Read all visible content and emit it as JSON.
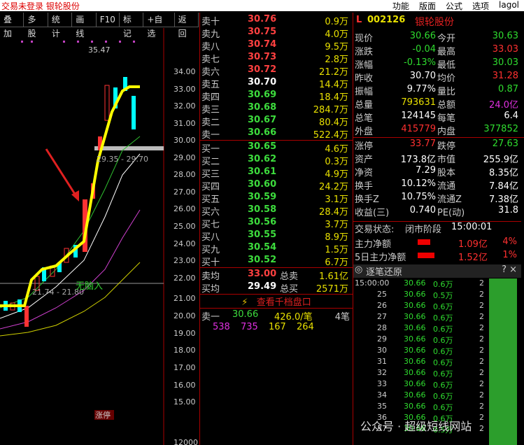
{
  "window": {
    "title": "交易未登录  银轮股份",
    "menus": [
      "功能",
      "版面",
      "公式",
      "选项",
      "lagol"
    ]
  },
  "toolbar": [
    "叠加",
    "多股",
    "统计",
    "画线",
    "F10",
    "标记",
    "+自选",
    "返回"
  ],
  "chart": {
    "price_axis": [
      "34.00",
      "33.00",
      "32.00",
      "31.00",
      "30.00",
      "29.00",
      "28.00",
      "27.00",
      "26.00",
      "25.00",
      "24.00",
      "23.00",
      "22.00",
      "21.00",
      "20.00",
      "19.00",
      "18.00",
      "17.00",
      "16.00",
      "15.00",
      "12000"
    ],
    "annotations": {
      "high": "35.47",
      "range1": "29.35 - 29.70",
      "range2": "21.74 - 21.80",
      "note": "无脑入",
      "tag": "涨停"
    }
  },
  "orderbook": {
    "asks": [
      {
        "label": "卖十",
        "price": "30.76",
        "vol": "0.9万",
        "p": "r"
      },
      {
        "label": "卖九",
        "price": "30.75",
        "vol": "4.0万",
        "p": "r"
      },
      {
        "label": "卖八",
        "price": "30.74",
        "vol": "9.5万",
        "p": "r"
      },
      {
        "label": "卖七",
        "price": "30.73",
        "vol": "2.8万",
        "p": "r"
      },
      {
        "label": "卖六",
        "price": "30.72",
        "vol": "21.2万",
        "p": "r"
      },
      {
        "label": "卖五",
        "price": "30.70",
        "vol": "14.4万",
        "p": "w"
      },
      {
        "label": "卖四",
        "price": "30.69",
        "vol": "18.4万",
        "p": "g"
      },
      {
        "label": "卖三",
        "price": "30.68",
        "vol": "284.7万",
        "p": "g"
      },
      {
        "label": "卖二",
        "price": "30.67",
        "vol": "80.4万",
        "p": "g"
      },
      {
        "label": "卖一",
        "price": "30.66",
        "vol": "522.4万",
        "p": "g"
      }
    ],
    "bids": [
      {
        "label": "买一",
        "price": "30.65",
        "vol": "4.6万",
        "p": "g"
      },
      {
        "label": "买二",
        "price": "30.62",
        "vol": "0.3万",
        "p": "g"
      },
      {
        "label": "买三",
        "price": "30.61",
        "vol": "4.9万",
        "p": "g"
      },
      {
        "label": "买四",
        "price": "30.60",
        "vol": "24.2万",
        "p": "g"
      },
      {
        "label": "买五",
        "price": "30.59",
        "vol": "3.1万",
        "p": "g"
      },
      {
        "label": "买六",
        "price": "30.58",
        "vol": "28.4万",
        "p": "g"
      },
      {
        "label": "买七",
        "price": "30.56",
        "vol": "3.7万",
        "p": "g"
      },
      {
        "label": "买八",
        "price": "30.55",
        "vol": "8.9万",
        "p": "g"
      },
      {
        "label": "买九",
        "price": "30.54",
        "vol": "1.5万",
        "p": "g"
      },
      {
        "label": "买十",
        "price": "30.52",
        "vol": "6.7万",
        "p": "g"
      }
    ],
    "avg_sell": {
      "label": "卖均",
      "price": "33.00",
      "total_label": "总卖",
      "total": "1.61亿"
    },
    "avg_buy": {
      "label": "买均",
      "price": "29.49",
      "total_label": "总买",
      "total": "2571万"
    },
    "button": "查看千档盘口",
    "detail": {
      "label": "卖一",
      "price": "30.66",
      "vol": "426.0/笔",
      "count": "4笔",
      "orders": [
        "538",
        "735",
        "167",
        "264"
      ]
    }
  },
  "quote": {
    "code": "002126",
    "name": "银轮股份",
    "rows": [
      [
        "现价",
        "30.66",
        "今开",
        "30.63",
        "grn",
        "grn"
      ],
      [
        "涨跌",
        "-0.04",
        "最高",
        "33.03",
        "grn",
        "red"
      ],
      [
        "涨幅",
        "-0.13%",
        "最低",
        "30.03",
        "grn",
        "grn"
      ],
      [
        "昨收",
        "30.70",
        "均价",
        "31.28",
        "wht",
        "red"
      ],
      [
        "振幅",
        "9.77%",
        "量比",
        "0.87",
        "wht",
        "grn"
      ],
      [
        "总量",
        "793631",
        "总额",
        "24.0亿",
        "yel",
        "mag"
      ],
      [
        "总笔",
        "124145",
        "每笔",
        "6.4",
        "wht",
        "wht"
      ],
      [
        "外盘",
        "415779",
        "内盘",
        "377852",
        "red",
        "grn"
      ],
      [
        "涨停",
        "33.77",
        "跌停",
        "27.63",
        "red",
        "grn"
      ],
      [
        "资产",
        "173.8亿",
        "市值",
        "255.9亿",
        "wht",
        "wht"
      ],
      [
        "净资",
        "7.29",
        "股本",
        "8.35亿",
        "wht",
        "wht"
      ],
      [
        "换手",
        "10.12%",
        "流通",
        "7.84亿",
        "wht",
        "wht"
      ],
      [
        "换手Z",
        "10.75%",
        "流通Z",
        "7.38亿",
        "wht",
        "wht"
      ],
      [
        "收益(三)",
        "0.740",
        "PE(动)",
        "31.8",
        "wht",
        "wht"
      ]
    ],
    "status_label": "交易状态:",
    "status": "闭市阶段",
    "status_time": "15:00:01",
    "netflow": [
      {
        "label": "主力净额",
        "val": "1.09亿",
        "pct": "4%"
      },
      {
        "label": "5日主力净额",
        "val": "1.52亿",
        "pct": "1%"
      }
    ],
    "trades_title": "逐笔还原",
    "trades": [
      [
        "15:00:00",
        "30.66",
        "0.6万",
        "2"
      ],
      [
        "25",
        "30.66",
        "0.5万",
        "2"
      ],
      [
        "26",
        "30.66",
        "0.6万",
        "2"
      ],
      [
        "27",
        "30.66",
        "0.6万",
        "2"
      ],
      [
        "28",
        "30.66",
        "0.6万",
        "2"
      ],
      [
        "29",
        "30.66",
        "0.6万",
        "2"
      ],
      [
        "30",
        "30.66",
        "0.6万",
        "2"
      ],
      [
        "31",
        "30.66",
        "0.6万",
        "2"
      ],
      [
        "32",
        "30.66",
        "0.6万",
        "2"
      ],
      [
        "33",
        "30.66",
        "0.6万",
        "2"
      ],
      [
        "34",
        "30.66",
        "0.6万",
        "2"
      ],
      [
        "35",
        "30.66",
        "0.6万",
        "2"
      ],
      [
        "36",
        "30.66",
        "0.6万",
        "2"
      ],
      [
        "37",
        "30.66",
        "0.5万",
        "2"
      ]
    ]
  },
  "watermark": "公众号 · 超级短线网站"
}
